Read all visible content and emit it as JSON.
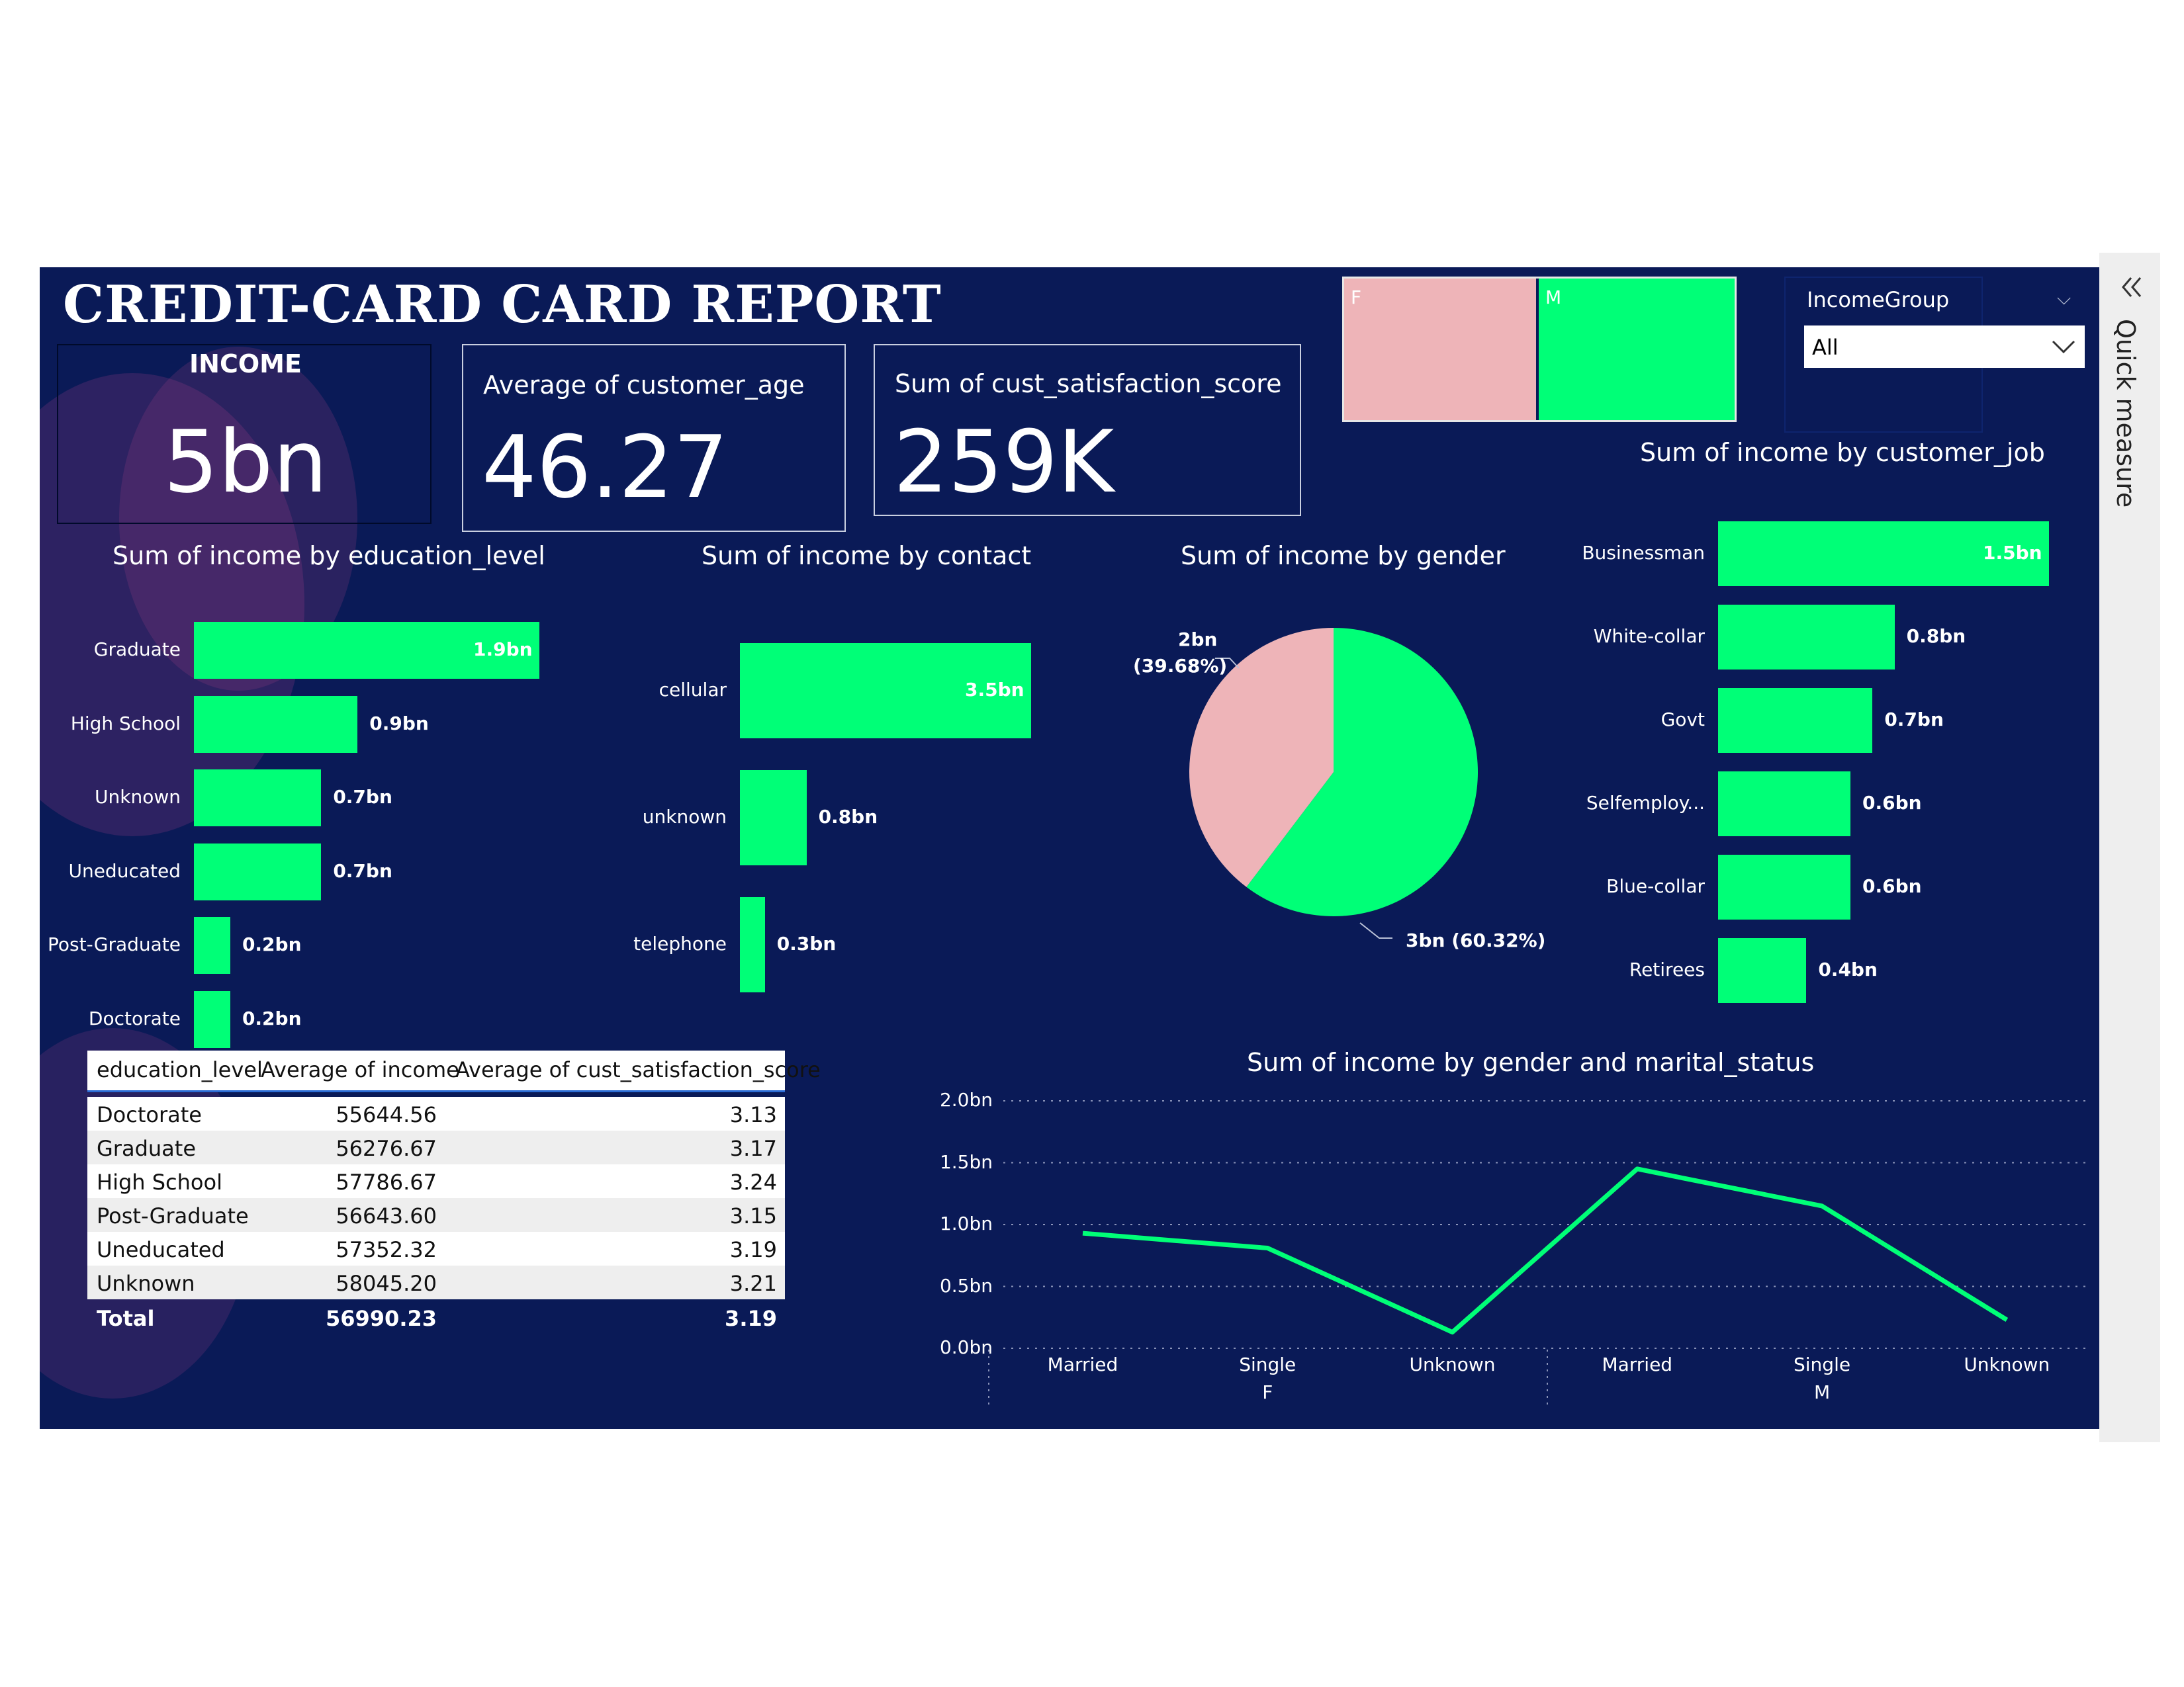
{
  "report": {
    "title": "CREDIT-CARD CARD REPORT",
    "accent_color": "#00ff77",
    "female_color": "#eeb4b8",
    "background_color": "#0a1a57"
  },
  "cards": {
    "income": {
      "label": "INCOME",
      "value": "5bn"
    },
    "age": {
      "label": "Average of customer_age",
      "value": "46.27"
    },
    "satisfaction": {
      "label": "Sum of cust_satisfaction_score",
      "value": "259K"
    }
  },
  "gender_treemap": {
    "f_label": "F",
    "m_label": "M"
  },
  "slicer": {
    "title": "IncomeGroup",
    "selected": "All"
  },
  "quick_measure": {
    "label": "Quick measure",
    "icon": "double-chevron-left-icon"
  },
  "education_chart": {
    "title": "Sum of income by education_level",
    "chart_data": {
      "type": "bar",
      "categories": [
        "Graduate",
        "High School",
        "Unknown",
        "Uneducated",
        "Post-Graduate",
        "Doctorate"
      ],
      "values": [
        1.9,
        0.9,
        0.7,
        0.7,
        0.2,
        0.2
      ],
      "labels": [
        "1.9bn",
        "0.9bn",
        "0.7bn",
        "0.7bn",
        "0.2bn",
        "0.2bn"
      ],
      "unit": "bn",
      "orientation": "horizontal"
    }
  },
  "contact_chart": {
    "title": "Sum of income by contact",
    "chart_data": {
      "type": "bar",
      "categories": [
        "cellular",
        "unknown",
        "telephone"
      ],
      "values": [
        3.5,
        0.8,
        0.3
      ],
      "labels": [
        "3.5bn",
        "0.8bn",
        "0.3bn"
      ],
      "unit": "bn",
      "orientation": "horizontal"
    }
  },
  "gender_chart": {
    "title": "Sum of income by gender",
    "chart_data": {
      "type": "pie",
      "categories": [
        "F",
        "M"
      ],
      "values": [
        39.68,
        60.32
      ],
      "labels": [
        "2bn",
        "3bn (60.32%)"
      ],
      "percent_label_f": "(39.68%)"
    }
  },
  "job_chart": {
    "title": "Sum of income by customer_job",
    "chart_data": {
      "type": "bar",
      "categories": [
        "Businessman",
        "White-collar",
        "Govt",
        "Selfemploy...",
        "Blue-collar",
        "Retirees"
      ],
      "values": [
        1.5,
        0.8,
        0.7,
        0.6,
        0.6,
        0.4
      ],
      "labels": [
        "1.5bn",
        "0.8bn",
        "0.7bn",
        "0.6bn",
        "0.6bn",
        "0.4bn"
      ],
      "unit": "bn",
      "orientation": "horizontal"
    }
  },
  "table": {
    "headers": [
      "education_level",
      "Average of income",
      "Average of cust_satisfaction_score"
    ],
    "rows": [
      [
        "Doctorate",
        "55644.56",
        "3.13"
      ],
      [
        "Graduate",
        "56276.67",
        "3.17"
      ],
      [
        "High School",
        "57786.67",
        "3.24"
      ],
      [
        "Post-Graduate",
        "56643.60",
        "3.15"
      ],
      [
        "Uneducated",
        "57352.32",
        "3.19"
      ],
      [
        "Unknown",
        "58045.20",
        "3.21"
      ]
    ],
    "total": [
      "Total",
      "56990.23",
      "3.19"
    ]
  },
  "marital_chart": {
    "title": "Sum of income by gender and marital_status",
    "chart_data": {
      "type": "line",
      "x": [
        "Married",
        "Single",
        "Unknown",
        "Married",
        "Single",
        "Unknown"
      ],
      "groups": [
        "F",
        "M"
      ],
      "values": [
        0.93,
        0.81,
        0.13,
        1.45,
        1.15,
        0.23
      ],
      "yticks": [
        "2.0bn",
        "1.5bn",
        "1.0bn",
        "0.5bn",
        "0.0bn"
      ],
      "ylim": [
        0,
        2.0
      ],
      "grid": true
    }
  }
}
